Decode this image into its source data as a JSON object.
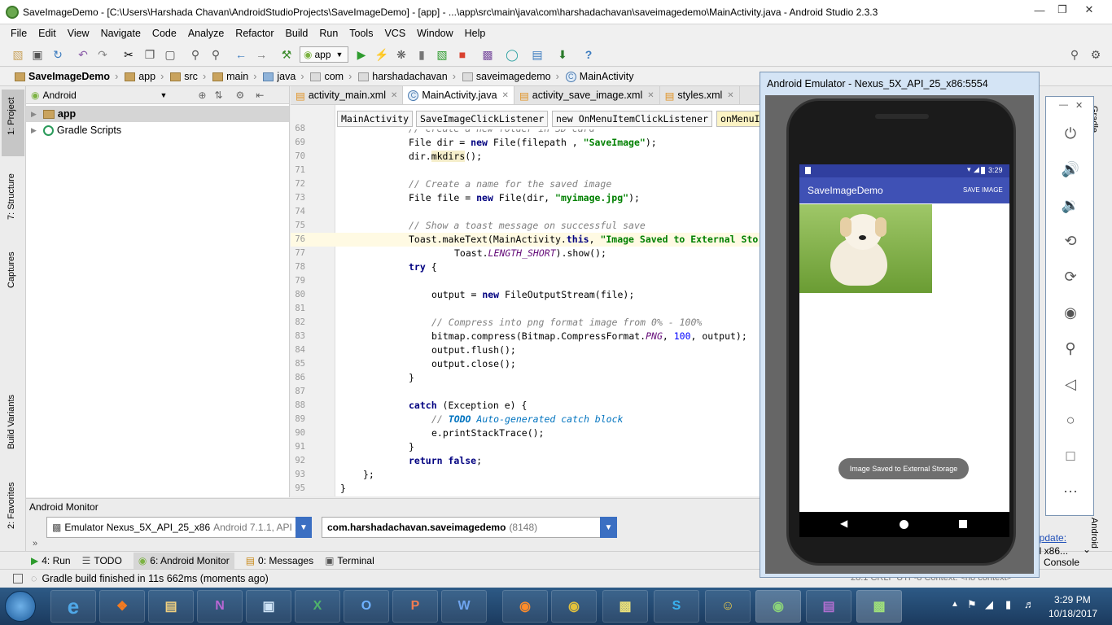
{
  "window": {
    "title": "SaveImageDemo - [C:\\Users\\Harshada Chavan\\AndroidStudioProjects\\SaveImageDemo] - [app] - ...\\app\\src\\main\\java\\com\\harshadachavan\\saveimagedemo\\MainActivity.java - Android Studio 2.3.3"
  },
  "menu": [
    "File",
    "Edit",
    "View",
    "Navigate",
    "Code",
    "Analyze",
    "Refactor",
    "Build",
    "Run",
    "Tools",
    "VCS",
    "Window",
    "Help"
  ],
  "toolbar": {
    "run_config": "app"
  },
  "breadcrumbs": [
    "SaveImageDemo",
    "app",
    "src",
    "main",
    "java",
    "com",
    "harshadachavan",
    "saveimagedemo",
    "MainActivity"
  ],
  "project": {
    "view_selector": "Android",
    "items": [
      "app",
      "Gradle Scripts"
    ]
  },
  "left_tabs": [
    "1: Project",
    "7: Structure",
    "Captures",
    "Build Variants",
    "2: Favorites"
  ],
  "editor_tabs": [
    {
      "label": "activity_main.xml"
    },
    {
      "label": "MainActivity.java"
    },
    {
      "label": "activity_save_image.xml"
    },
    {
      "label": "styles.xml"
    }
  ],
  "code_breadcrumbs": [
    "MainActivity",
    "SaveImageClickListener",
    "new OnMenuItemClickListener",
    "onMenuI"
  ],
  "code_lines": [
    {
      "n": "68",
      "t": "// Create a new folder in SD card"
    },
    {
      "n": "69",
      "t": "File dir = new File(filepath , \"SaveImage\");"
    },
    {
      "n": "70",
      "t": "dir.mkdirs();"
    },
    {
      "n": "71",
      "t": ""
    },
    {
      "n": "72",
      "t": "// Create a name for the saved image"
    },
    {
      "n": "73",
      "t": "File file = new File(dir, \"myimage.jpg\");"
    },
    {
      "n": "74",
      "t": ""
    },
    {
      "n": "75",
      "t": "// Show a toast message on successful save"
    },
    {
      "n": "76",
      "t": "Toast.makeText(MainActivity.this, \"Image Saved to External Sto"
    },
    {
      "n": "77",
      "t": "Toast.LENGTH_SHORT).show();"
    },
    {
      "n": "78",
      "t": "try {"
    },
    {
      "n": "79",
      "t": ""
    },
    {
      "n": "80",
      "t": "output = new FileOutputStream(file);"
    },
    {
      "n": "81",
      "t": ""
    },
    {
      "n": "82",
      "t": "// Compress into png format image from 0% - 100%"
    },
    {
      "n": "83",
      "t": "bitmap.compress(Bitmap.CompressFormat.PNG, 100, output);"
    },
    {
      "n": "84",
      "t": "output.flush();"
    },
    {
      "n": "85",
      "t": "output.close();"
    },
    {
      "n": "86",
      "t": "}"
    },
    {
      "n": "87",
      "t": ""
    },
    {
      "n": "88",
      "t": "catch (Exception e) {"
    },
    {
      "n": "89",
      "t": "// TODO Auto-generated catch block"
    },
    {
      "n": "90",
      "t": "e.printStackTrace();"
    },
    {
      "n": "91",
      "t": "}"
    },
    {
      "n": "92",
      "t": "return false;"
    },
    {
      "n": "93",
      "t": "};"
    },
    {
      "n": "95",
      "t": "}"
    }
  ],
  "monitor": {
    "title": "Android Monitor",
    "device": "Emulator Nexus_5X_API_25_x86",
    "device_detail": "Android 7.1.1, API 25",
    "process": "com.harshadachavan.saveimagedemo",
    "pid": "(8148)"
  },
  "bottom_tabs": [
    "4: Run",
    "TODO",
    "6: Android Monitor",
    "0: Messages",
    "Terminal"
  ],
  "status": {
    "text": "Gradle build finished in 11s 662ms (moments ago)",
    "right": "28:1  CRLF  UTF-8  Context: <no context>"
  },
  "emulator": {
    "title": "Android Emulator - Nexus_5X_API_25_x86:5554",
    "clock": "3:29",
    "app_title": "SaveImageDemo",
    "action": "SAVE IMAGE",
    "toast": "Image Saved to External Storage"
  },
  "right_panel_fragments": [
    "Gradle",
    "Android",
    "update:",
    "ul x86...",
    "Console"
  ],
  "taskbar": {
    "time": "3:29 PM",
    "date": "10/18/2017"
  },
  "colors": {
    "accent": "#3f51b5",
    "statusbar": "#303f9f",
    "caret_line": "#fffae3"
  }
}
